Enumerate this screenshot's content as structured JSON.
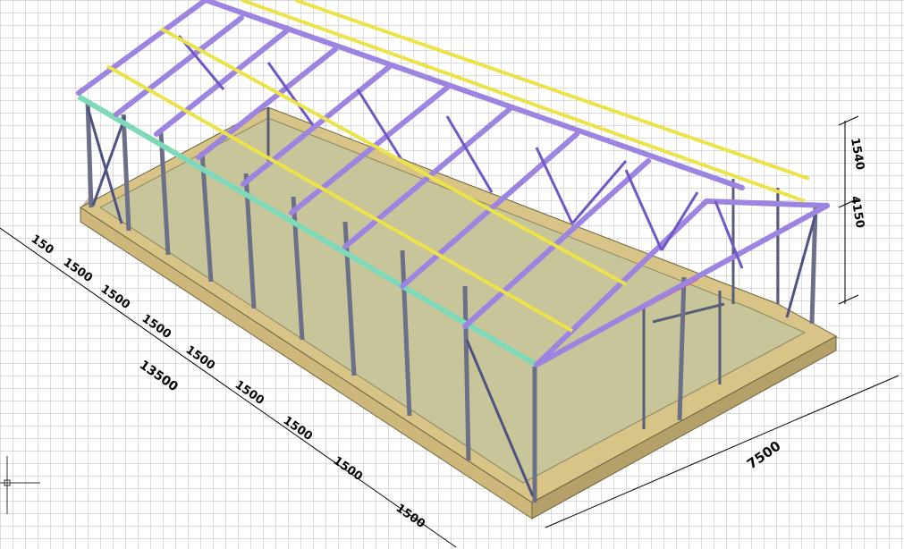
{
  "dimensions": {
    "left_segments": [
      "150",
      "1500",
      "1500",
      "1500",
      "1500",
      "1500",
      "1500",
      "1500",
      "1500"
    ],
    "total_length": "13500",
    "width": "7500",
    "height_upper": "1540",
    "height_total": "4150"
  },
  "colors": {
    "background": "#ffffff",
    "grid": "#b4b4b4",
    "truss": "#9c84e0",
    "truss_dark": "#5b4aa8",
    "purlin": "#ece24a",
    "column": "#7e8196",
    "floor": "#c8c49a",
    "base": "#d8c486",
    "eave_beam": "#7ed9b8",
    "highlight": "#ff4a4a"
  },
  "icons": {
    "axes": "ucs-axes-icon"
  }
}
